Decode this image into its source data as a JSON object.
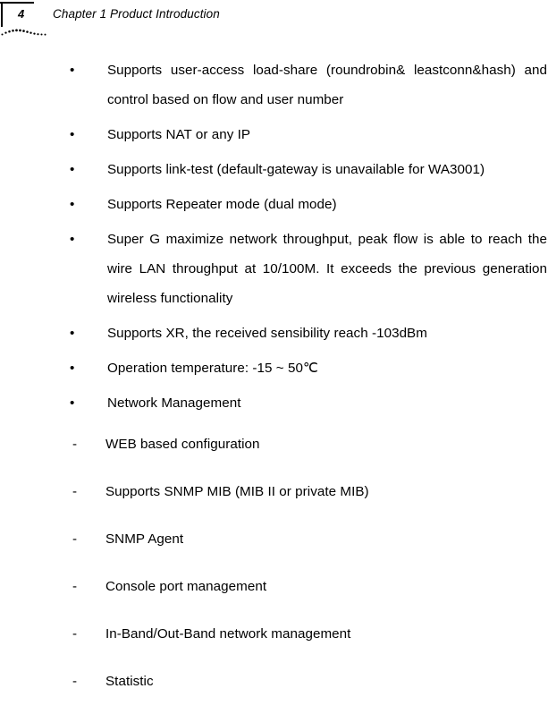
{
  "header": {
    "page_number": "4",
    "title": "Chapter 1 Product Introduction",
    "corner_bracket": "corner-bracket-rule",
    "decoration": "dotted-arc-decoration"
  },
  "content": {
    "bullet_marker": "•",
    "dash_marker": "-",
    "bullets": [
      {
        "text": "Supports user-access load-share (roundrobin& leastconn&hash) and control based on flow and user number",
        "multiline": true
      },
      {
        "text": "Supports NAT or any IP",
        "multiline": false
      },
      {
        "text": "Supports link-test (default-gateway is unavailable for WA3001)",
        "multiline": true
      },
      {
        "text": "Supports Repeater mode (dual mode)",
        "multiline": false
      },
      {
        "text": "Super G maximize network throughput, peak flow is able to reach the wire LAN throughput at 10/100M. It exceeds the previous generation wireless functionality",
        "multiline": true
      },
      {
        "text": "Supports XR, the received sensibility reach -103dBm",
        "multiline": false
      },
      {
        "text": "Operation temperature: -15 ~ 50℃",
        "multiline": false
      },
      {
        "text": "Network Management",
        "multiline": false
      }
    ],
    "sub_items": [
      {
        "text": "WEB based configuration"
      },
      {
        "text": "Supports SNMP MIB (MIB II or private MIB)"
      },
      {
        "text": "SNMP Agent"
      },
      {
        "text": "Console port management"
      },
      {
        "text": "In-Band/Out-Band network management"
      },
      {
        "text": "Statistic"
      }
    ]
  }
}
